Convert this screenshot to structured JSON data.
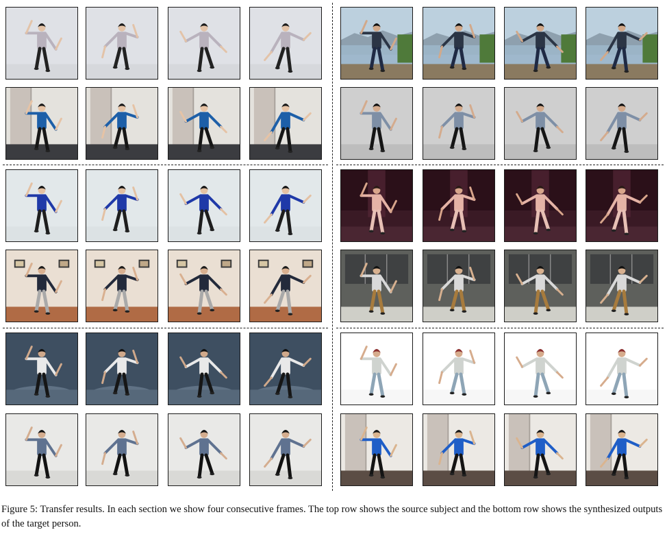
{
  "caption": "Figure 5: Transfer results. In each section we show four consecutive frames. The top row shows the source subject and the bottom row shows the synthesized outputs of the target person.",
  "grid": {
    "sections": [
      {
        "name": "section-left-1",
        "source": {
          "bg": "#dfe1e6",
          "floor": "#d6d8dc",
          "shirt": "#b9b2bd",
          "pants": "#222222",
          "skin": "#e3c3a8",
          "hair": "#1a1a1a",
          "scene": "plain"
        },
        "target": {
          "bg": "#e4e2dd",
          "floor": "#3b3c40",
          "shirt": "#1d5fa8",
          "pants": "#161616",
          "skin": "#e6c3a5",
          "hair": "#1a1a1a",
          "scene": "door"
        }
      },
      {
        "name": "section-right-1",
        "source": {
          "bg": "#9fb8cc",
          "floor": "#8a7a60",
          "shirt": "#2b3545",
          "pants": "#1f2a44",
          "skin": "#d2a98a",
          "hair": "#111111",
          "scene": "outdoor"
        },
        "target": {
          "bg": "#cfcfcf",
          "floor": "#bdbdbd",
          "shirt": "#7e8fa6",
          "pants": "#151515",
          "skin": "#d4ab8d",
          "hair": "#111111",
          "scene": "plain"
        }
      },
      {
        "name": "section-left-2",
        "source": {
          "bg": "#e2e8ea",
          "floor": "#dce2e4",
          "shirt": "#1f39a8",
          "pants": "#1e1e1e",
          "skin": "#e4c1a3",
          "hair": "#121212",
          "scene": "plain"
        },
        "target": {
          "bg": "#eadfd3",
          "floor": "#b06b45",
          "shirt": "#232a3b",
          "pants": "#a9a9a9",
          "skin": "#d9b090",
          "hair": "#1a1a1a",
          "scene": "pictures"
        }
      },
      {
        "name": "section-right-2",
        "source": {
          "bg": "#3a1a25",
          "floor": "#4a2632",
          "shirt": "#e5b3a6",
          "pants": "#e7c0b5",
          "skin": "#d8a58b",
          "hair": "#2a1b16",
          "scene": "stage"
        },
        "target": {
          "bg": "#5e605c",
          "floor": "#cfcfc8",
          "shirt": "#d9d9d9",
          "pants": "#a77b3d",
          "skin": "#d7b08f",
          "hair": "#111111",
          "scene": "windows"
        }
      },
      {
        "name": "section-left-3",
        "source": {
          "bg": "#3e4f61",
          "floor": "#56687a",
          "shirt": "#e9e9e9",
          "pants": "#161616",
          "skin": "#d0a98b",
          "hair": "#111111",
          "scene": "dark"
        },
        "target": {
          "bg": "#e9e9e7",
          "floor": "#d9d9d6",
          "shirt": "#5f7290",
          "pants": "#121212",
          "skin": "#d4ad8f",
          "hair": "#111111",
          "scene": "plain"
        }
      },
      {
        "name": "section-right-3",
        "source": {
          "bg": "#ffffff",
          "floor": "#f7f7f7",
          "shirt": "#cfd3cf",
          "pants": "#8ea5b6",
          "skin": "#d6ac8d",
          "hair": "#8a2e2e",
          "scene": "plain"
        },
        "target": {
          "bg": "#ece9e4",
          "floor": "#5b4d45",
          "shirt": "#1f5ec7",
          "pants": "#141414",
          "skin": "#dab48f",
          "hair": "#151515",
          "scene": "door"
        }
      }
    ]
  }
}
